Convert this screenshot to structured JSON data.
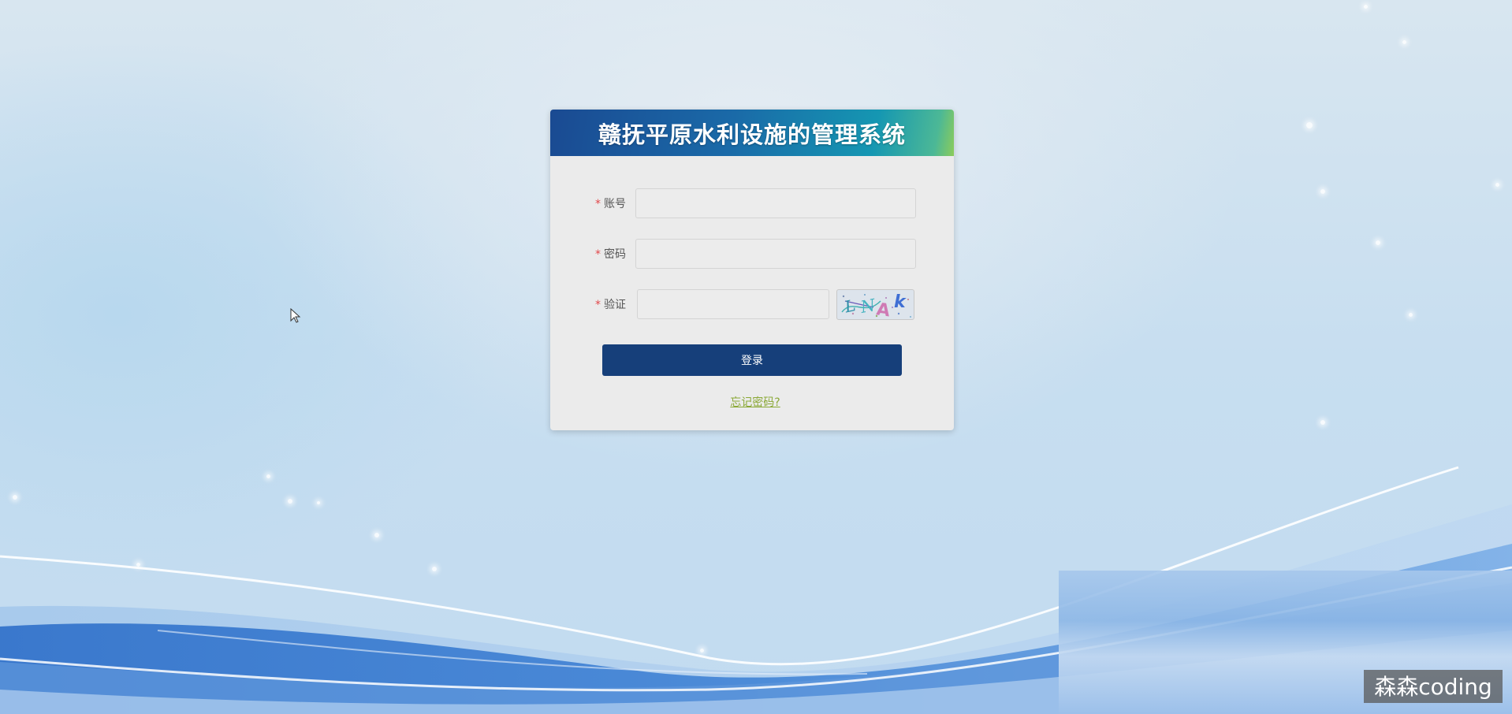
{
  "header": {
    "title": "赣抚平原水利设施的管理系统"
  },
  "form": {
    "required_mark": "*",
    "account_label": "账号",
    "account_value": "",
    "password_label": "密码",
    "password_value": "",
    "captcha_label": "验证",
    "captcha_value": "",
    "captcha_text": "LNAk"
  },
  "actions": {
    "login_label": "登录",
    "forgot_label": "忘记密码?"
  },
  "watermark": {
    "text": "森森coding"
  },
  "colors": {
    "primary_button": "#163f7a",
    "required_mark": "#e2474a",
    "link": "#8aa836",
    "header_gradient_start": "#1a4a92",
    "header_gradient_end": "#8ccc5a"
  },
  "icons": {
    "cursor": "arrow-cursor-icon"
  }
}
